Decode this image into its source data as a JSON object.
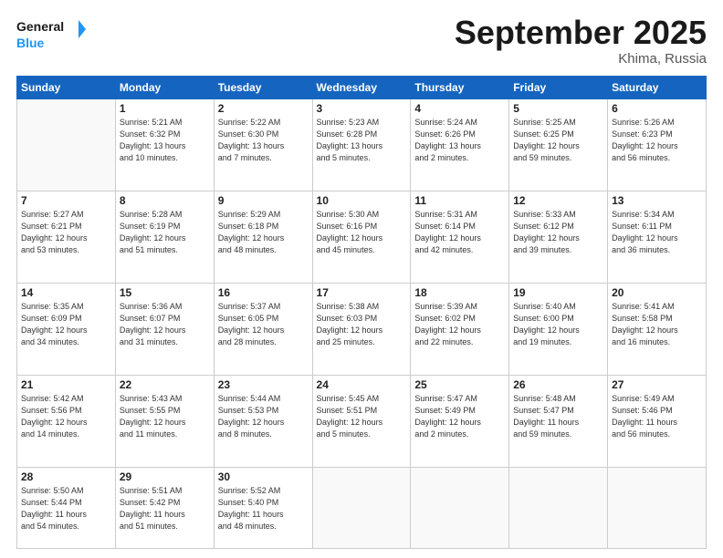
{
  "header": {
    "logo_general": "General",
    "logo_blue": "Blue",
    "month": "September 2025",
    "location": "Khima, Russia"
  },
  "days_of_week": [
    "Sunday",
    "Monday",
    "Tuesday",
    "Wednesday",
    "Thursday",
    "Friday",
    "Saturday"
  ],
  "weeks": [
    [
      {
        "day": "",
        "info": ""
      },
      {
        "day": "1",
        "info": "Sunrise: 5:21 AM\nSunset: 6:32 PM\nDaylight: 13 hours\nand 10 minutes."
      },
      {
        "day": "2",
        "info": "Sunrise: 5:22 AM\nSunset: 6:30 PM\nDaylight: 13 hours\nand 7 minutes."
      },
      {
        "day": "3",
        "info": "Sunrise: 5:23 AM\nSunset: 6:28 PM\nDaylight: 13 hours\nand 5 minutes."
      },
      {
        "day": "4",
        "info": "Sunrise: 5:24 AM\nSunset: 6:26 PM\nDaylight: 13 hours\nand 2 minutes."
      },
      {
        "day": "5",
        "info": "Sunrise: 5:25 AM\nSunset: 6:25 PM\nDaylight: 12 hours\nand 59 minutes."
      },
      {
        "day": "6",
        "info": "Sunrise: 5:26 AM\nSunset: 6:23 PM\nDaylight: 12 hours\nand 56 minutes."
      }
    ],
    [
      {
        "day": "7",
        "info": "Sunrise: 5:27 AM\nSunset: 6:21 PM\nDaylight: 12 hours\nand 53 minutes."
      },
      {
        "day": "8",
        "info": "Sunrise: 5:28 AM\nSunset: 6:19 PM\nDaylight: 12 hours\nand 51 minutes."
      },
      {
        "day": "9",
        "info": "Sunrise: 5:29 AM\nSunset: 6:18 PM\nDaylight: 12 hours\nand 48 minutes."
      },
      {
        "day": "10",
        "info": "Sunrise: 5:30 AM\nSunset: 6:16 PM\nDaylight: 12 hours\nand 45 minutes."
      },
      {
        "day": "11",
        "info": "Sunrise: 5:31 AM\nSunset: 6:14 PM\nDaylight: 12 hours\nand 42 minutes."
      },
      {
        "day": "12",
        "info": "Sunrise: 5:33 AM\nSunset: 6:12 PM\nDaylight: 12 hours\nand 39 minutes."
      },
      {
        "day": "13",
        "info": "Sunrise: 5:34 AM\nSunset: 6:11 PM\nDaylight: 12 hours\nand 36 minutes."
      }
    ],
    [
      {
        "day": "14",
        "info": "Sunrise: 5:35 AM\nSunset: 6:09 PM\nDaylight: 12 hours\nand 34 minutes."
      },
      {
        "day": "15",
        "info": "Sunrise: 5:36 AM\nSunset: 6:07 PM\nDaylight: 12 hours\nand 31 minutes."
      },
      {
        "day": "16",
        "info": "Sunrise: 5:37 AM\nSunset: 6:05 PM\nDaylight: 12 hours\nand 28 minutes."
      },
      {
        "day": "17",
        "info": "Sunrise: 5:38 AM\nSunset: 6:03 PM\nDaylight: 12 hours\nand 25 minutes."
      },
      {
        "day": "18",
        "info": "Sunrise: 5:39 AM\nSunset: 6:02 PM\nDaylight: 12 hours\nand 22 minutes."
      },
      {
        "day": "19",
        "info": "Sunrise: 5:40 AM\nSunset: 6:00 PM\nDaylight: 12 hours\nand 19 minutes."
      },
      {
        "day": "20",
        "info": "Sunrise: 5:41 AM\nSunset: 5:58 PM\nDaylight: 12 hours\nand 16 minutes."
      }
    ],
    [
      {
        "day": "21",
        "info": "Sunrise: 5:42 AM\nSunset: 5:56 PM\nDaylight: 12 hours\nand 14 minutes."
      },
      {
        "day": "22",
        "info": "Sunrise: 5:43 AM\nSunset: 5:55 PM\nDaylight: 12 hours\nand 11 minutes."
      },
      {
        "day": "23",
        "info": "Sunrise: 5:44 AM\nSunset: 5:53 PM\nDaylight: 12 hours\nand 8 minutes."
      },
      {
        "day": "24",
        "info": "Sunrise: 5:45 AM\nSunset: 5:51 PM\nDaylight: 12 hours\nand 5 minutes."
      },
      {
        "day": "25",
        "info": "Sunrise: 5:47 AM\nSunset: 5:49 PM\nDaylight: 12 hours\nand 2 minutes."
      },
      {
        "day": "26",
        "info": "Sunrise: 5:48 AM\nSunset: 5:47 PM\nDaylight: 11 hours\nand 59 minutes."
      },
      {
        "day": "27",
        "info": "Sunrise: 5:49 AM\nSunset: 5:46 PM\nDaylight: 11 hours\nand 56 minutes."
      }
    ],
    [
      {
        "day": "28",
        "info": "Sunrise: 5:50 AM\nSunset: 5:44 PM\nDaylight: 11 hours\nand 54 minutes."
      },
      {
        "day": "29",
        "info": "Sunrise: 5:51 AM\nSunset: 5:42 PM\nDaylight: 11 hours\nand 51 minutes."
      },
      {
        "day": "30",
        "info": "Sunrise: 5:52 AM\nSunset: 5:40 PM\nDaylight: 11 hours\nand 48 minutes."
      },
      {
        "day": "",
        "info": ""
      },
      {
        "day": "",
        "info": ""
      },
      {
        "day": "",
        "info": ""
      },
      {
        "day": "",
        "info": ""
      }
    ]
  ]
}
